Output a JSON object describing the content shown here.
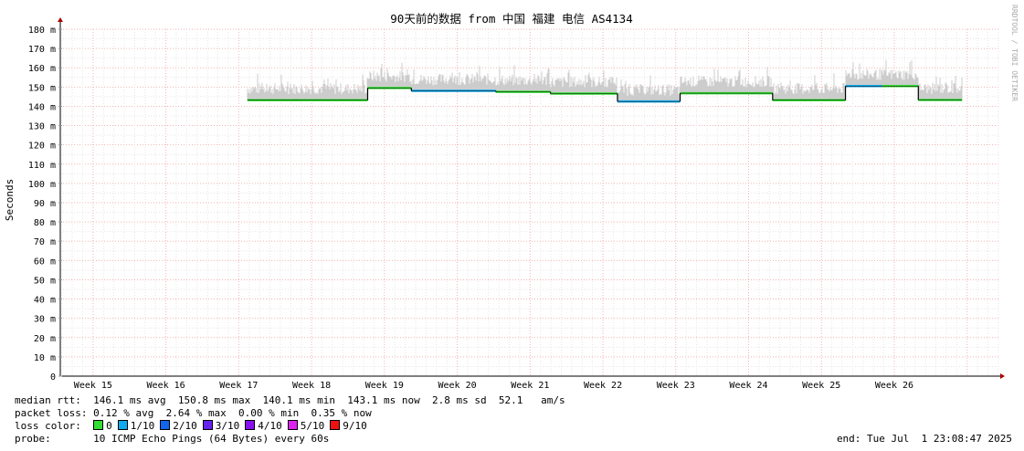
{
  "chart_data": {
    "type": "line",
    "title": "90天前的数据 from 中国 福建 电信 AS4134",
    "ylabel": "Seconds",
    "watermark": "RRDTOOL / TOBI OETIKER",
    "ylim": [
      0,
      180
    ],
    "yticks": [
      "0",
      "10 m",
      "20 m",
      "30 m",
      "40 m",
      "50 m",
      "60 m",
      "70 m",
      "80 m",
      "90 m",
      "100 m",
      "110 m",
      "120 m",
      "130 m",
      "140 m",
      "150 m",
      "160 m",
      "170 m",
      "180 m"
    ],
    "xlim": [
      14.55,
      27.43
    ],
    "xticks": [
      "Week 15",
      "Week 16",
      "Week 17",
      "Week 18",
      "Week 19",
      "Week 20",
      "Week 21",
      "Week 22",
      "Week 23",
      "Week 24",
      "Week 25",
      "Week 26"
    ],
    "grid": true,
    "median_series": [
      {
        "x_start": 17.12,
        "x_end": 18.77,
        "y": 143.2
      },
      {
        "x_start": 18.77,
        "x_end": 19.37,
        "y": 149.5
      },
      {
        "x_start": 19.37,
        "x_end": 20.53,
        "y": 148.0
      },
      {
        "x_start": 20.53,
        "x_end": 21.28,
        "y": 147.5
      },
      {
        "x_start": 21.28,
        "x_end": 22.2,
        "y": 146.6
      },
      {
        "x_start": 22.2,
        "x_end": 23.06,
        "y": 142.5
      },
      {
        "x_start": 23.06,
        "x_end": 24.33,
        "y": 146.8
      },
      {
        "x_start": 24.33,
        "x_end": 25.33,
        "y": 143.2
      },
      {
        "x_start": 25.33,
        "x_end": 25.83,
        "y": 150.5
      },
      {
        "x_start": 25.83,
        "x_end": 26.33,
        "y": 150.5
      },
      {
        "x_start": 26.33,
        "x_end": 26.93,
        "y": 143.3
      }
    ],
    "loss_colors": [
      "#33dd33",
      "#11aaee",
      "#1166ee",
      "#6622ee",
      "#8811ee",
      "#dd22ee",
      "#ee1111"
    ]
  },
  "stats": {
    "median_rtt_label": "median rtt:",
    "median_rtt_values": "146.1 ms avg  150.8 ms max  140.1 ms min  143.1 ms now  2.8 ms sd  52.1   am/s",
    "packet_loss_label": "packet loss:",
    "packet_loss_values": "0.12 % avg  2.64 % max  0.00 % min  0.35 % now",
    "loss_color_label": "loss color:",
    "loss_legend": [
      "0",
      "1/10",
      "2/10",
      "3/10",
      "4/10",
      "5/10",
      "9/10"
    ],
    "probe_label": "probe:",
    "probe_value": "10 ICMP Echo Pings (64 Bytes) every 60s",
    "end_value": "end: Tue Jul  1 23:08:47 2025"
  }
}
